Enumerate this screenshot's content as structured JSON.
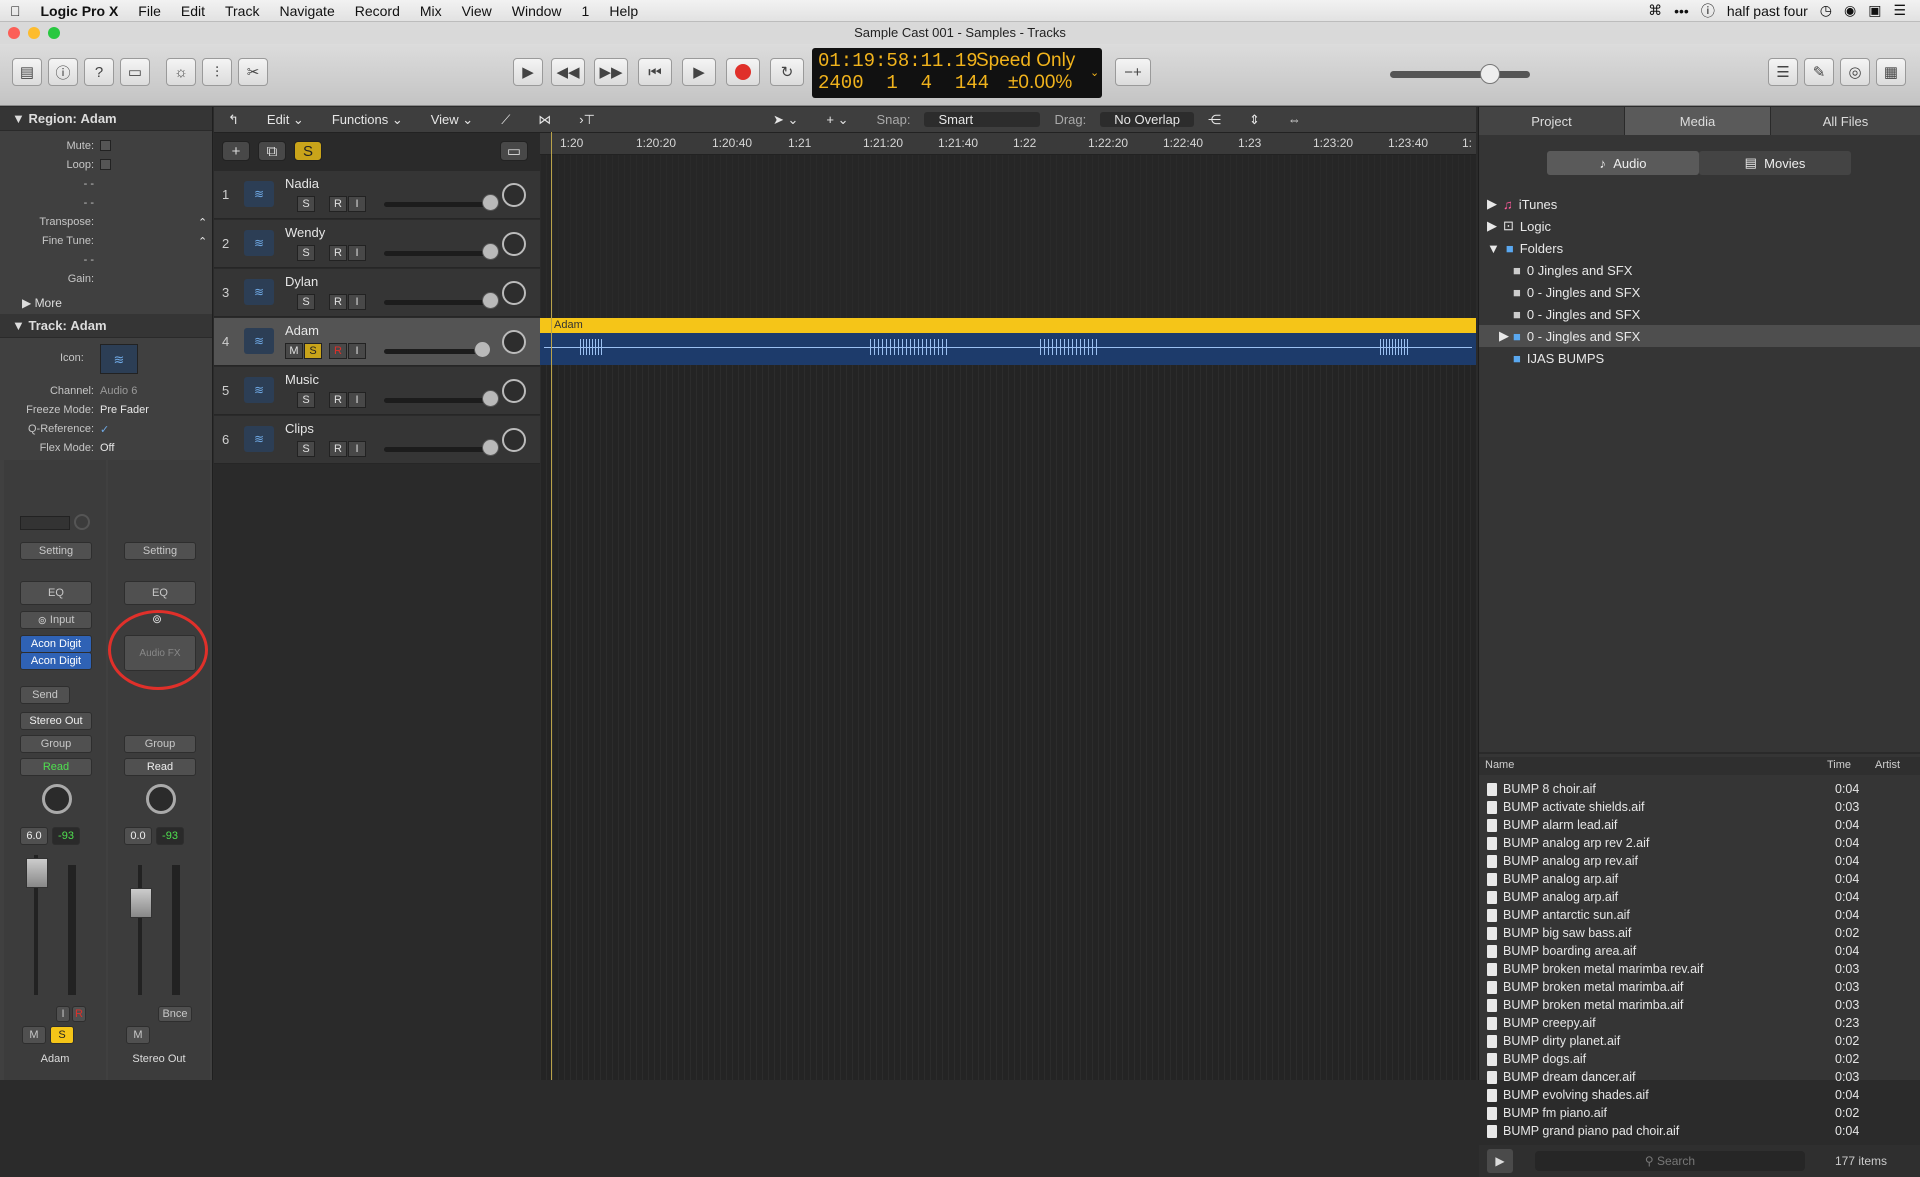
{
  "menubar": {
    "app": "Logic Pro X",
    "items": [
      "File",
      "Edit",
      "Track",
      "Navigate",
      "Record",
      "Mix",
      "View",
      "Window",
      "1",
      "Help"
    ],
    "right_user": "half past four"
  },
  "window_title": "Sample Cast 001 - Samples - Tracks",
  "lcd": {
    "time": "01:19:58:11.19",
    "bars": "2400  1  4  144",
    "mode": "Speed Only",
    "speed": "±0.00%"
  },
  "region_inspector": {
    "header": "Region:",
    "name": "Adam",
    "rows": [
      {
        "label": "Mute:",
        "value": ""
      },
      {
        "label": "Loop:",
        "value": ""
      },
      {
        "label": "-  -",
        "value": ""
      },
      {
        "label": "-  -",
        "value": ""
      },
      {
        "label": "Transpose:",
        "value": ""
      },
      {
        "label": "Fine Tune:",
        "value": ""
      },
      {
        "label": "-  -",
        "value": ""
      },
      {
        "label": "Gain:",
        "value": ""
      }
    ],
    "more": "More"
  },
  "track_inspector": {
    "header": "Track:",
    "name": "Adam",
    "icon_label": "Icon:",
    "rows": [
      {
        "label": "Channel:",
        "value": "Audio 6"
      },
      {
        "label": "Freeze Mode:",
        "value": "Pre Fader"
      },
      {
        "label": "Q-Reference:",
        "value": "✓"
      },
      {
        "label": "Flex Mode:",
        "value": "Off"
      }
    ]
  },
  "strips": [
    {
      "setting": "Setting",
      "eq": "EQ",
      "input": "Input",
      "plugins": [
        "Acon Digit",
        "Acon Digit"
      ],
      "send": "Send",
      "output": "Stereo Out",
      "group": "Group",
      "automation": "Read",
      "vol": "6.0",
      "peak": "-93",
      "ir": [
        "I",
        "R"
      ],
      "ms": [
        "M",
        "S"
      ],
      "name": "Adam"
    },
    {
      "setting": "Setting",
      "eq": "EQ",
      "audiofx": "Audio FX",
      "group": "Group",
      "automation": "Read",
      "vol": "0.0",
      "peak": "-93",
      "bnce": "Bnce",
      "ms": [
        "M"
      ],
      "name": "Stereo Out"
    }
  ],
  "tracks_toolbar": {
    "edit": "Edit",
    "functions": "Functions",
    "view": "View",
    "snap_label": "Snap:",
    "snap_value": "Smart",
    "drag_label": "Drag:",
    "drag_value": "No Overlap"
  },
  "track_buttons": {
    "solo_all": "S"
  },
  "tracks": [
    {
      "num": "1",
      "name": "Nadia"
    },
    {
      "num": "2",
      "name": "Wendy"
    },
    {
      "num": "3",
      "name": "Dylan"
    },
    {
      "num": "4",
      "name": "Adam"
    },
    {
      "num": "5",
      "name": "Music"
    },
    {
      "num": "6",
      "name": "Clips"
    }
  ],
  "ruler_labels": [
    "1:20",
    "1:20:20",
    "1:20:40",
    "1:21",
    "1:21:20",
    "1:21:40",
    "1:22",
    "1:22:20",
    "1:22:40",
    "1:23",
    "1:23:20",
    "1:23:40",
    "1:"
  ],
  "region": {
    "name": "Adam"
  },
  "browser": {
    "tabs": [
      "Project",
      "Media",
      "All Files"
    ],
    "subtabs": [
      "Audio",
      "Movies"
    ],
    "tree": [
      {
        "label": "iTunes",
        "indent": 0
      },
      {
        "label": "Logic",
        "indent": 0
      },
      {
        "label": "Folders",
        "indent": 0
      },
      {
        "label": "0 Jingles and SFX",
        "indent": 1
      },
      {
        "label": "0 - Jingles and SFX",
        "indent": 1
      },
      {
        "label": "0 - Jingles and SFX",
        "indent": 1
      },
      {
        "label": "0 - Jingles and SFX",
        "indent": 1
      },
      {
        "label": "IJAS BUMPS",
        "indent": 1
      }
    ],
    "columns": [
      "Name",
      "Time",
      "Artist"
    ],
    "files": [
      {
        "name": "BUMP 8 choir.aif",
        "time": "0:04"
      },
      {
        "name": "BUMP activate shields.aif",
        "time": "0:03"
      },
      {
        "name": "BUMP alarm lead.aif",
        "time": "0:04"
      },
      {
        "name": "BUMP analog arp rev 2.aif",
        "time": "0:04"
      },
      {
        "name": "BUMP analog arp rev.aif",
        "time": "0:04"
      },
      {
        "name": "BUMP analog arp.aif",
        "time": "0:04"
      },
      {
        "name": "BUMP analog arp.aif",
        "time": "0:04"
      },
      {
        "name": "BUMP antarctic sun.aif",
        "time": "0:04"
      },
      {
        "name": "BUMP big saw bass.aif",
        "time": "0:02"
      },
      {
        "name": "BUMP boarding area.aif",
        "time": "0:04"
      },
      {
        "name": "BUMP broken metal marimba rev.aif",
        "time": "0:03"
      },
      {
        "name": "BUMP broken metal marimba.aif",
        "time": "0:03"
      },
      {
        "name": "BUMP broken metal marimba.aif",
        "time": "0:03"
      },
      {
        "name": "BUMP creepy.aif",
        "time": "0:23"
      },
      {
        "name": "BUMP dirty planet.aif",
        "time": "0:02"
      },
      {
        "name": "BUMP dogs.aif",
        "time": "0:02"
      },
      {
        "name": "BUMP dream dancer.aif",
        "time": "0:03"
      },
      {
        "name": "BUMP evolving shades.aif",
        "time": "0:04"
      },
      {
        "name": "BUMP fm piano.aif",
        "time": "0:02"
      },
      {
        "name": "BUMP grand piano pad choir.aif",
        "time": "0:04"
      }
    ],
    "search_placeholder": "Search",
    "count": "177 items"
  },
  "colors": {
    "accent_yellow": "#f5c518",
    "record_red": "#e0302a",
    "region_blue": "#1d3b6b",
    "read_green": "#4fe04f"
  }
}
